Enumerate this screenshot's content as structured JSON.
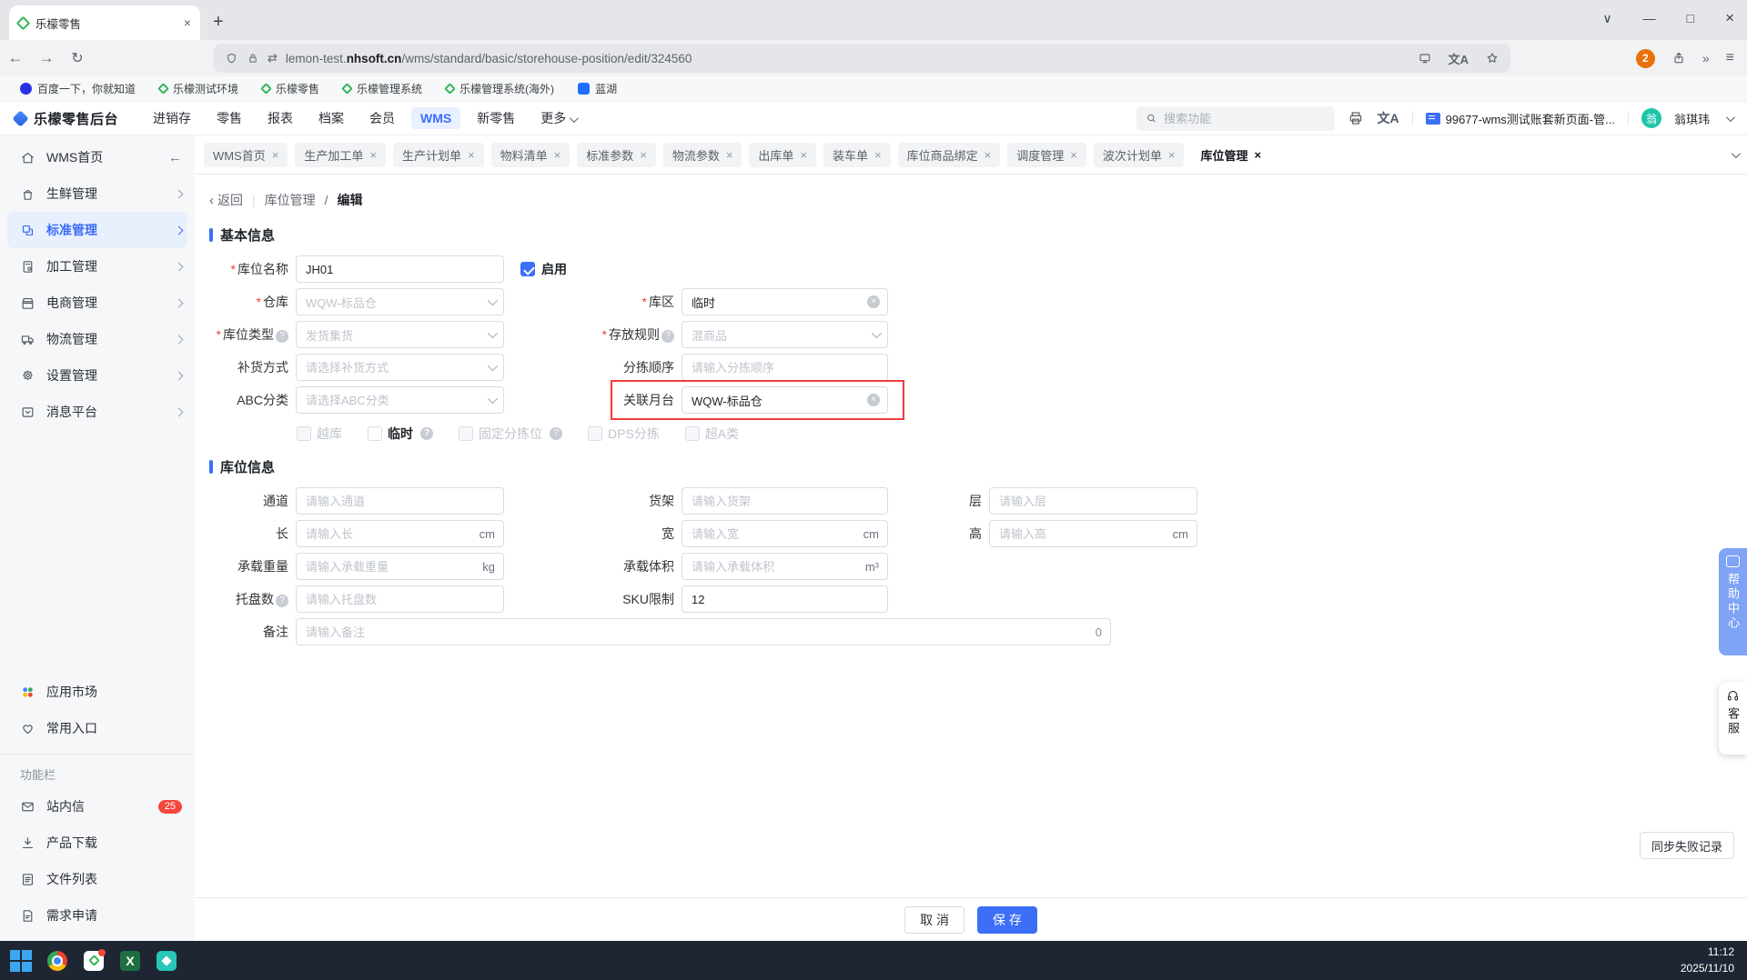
{
  "browser": {
    "tab_title": "乐檬零售",
    "url_prefix": "lemon-test.",
    "url_domain": "nhsoft.cn",
    "url_path": "/wms/standard/basic/storehouse-position/edit/324560",
    "profile_badge": "2",
    "bookmarks": [
      {
        "label": "百度一下，你就知道"
      },
      {
        "label": "乐檬测试环境"
      },
      {
        "label": "乐檬零售"
      },
      {
        "label": "乐檬管理系统"
      },
      {
        "label": "乐檬管理系统(海外)"
      },
      {
        "label": "蓝湖"
      }
    ],
    "glyphs": {
      "back": "←",
      "forward": "→",
      "reload": "↻",
      "newtab": "+",
      "close": "×",
      "min": "—",
      "max": "□",
      "caret": "∨",
      "more": "»",
      "menu": "≡",
      "switch": "⇄"
    }
  },
  "header": {
    "brand": "乐檬零售后台",
    "nav": [
      {
        "label": "进销存"
      },
      {
        "label": "零售"
      },
      {
        "label": "报表"
      },
      {
        "label": "档案"
      },
      {
        "label": "会员"
      },
      {
        "label": "WMS"
      },
      {
        "label": "新零售"
      },
      {
        "label": "更多"
      }
    ],
    "search_placeholder": "搜索功能",
    "translate_glyph": "文A",
    "account": "99677-wms测试账套新页面-管...",
    "avatar_char": "翁",
    "user_name": "翁琪玮"
  },
  "sidebar": {
    "items": [
      {
        "label": "WMS首页"
      },
      {
        "label": "生鲜管理"
      },
      {
        "label": "标准管理"
      },
      {
        "label": "加工管理"
      },
      {
        "label": "电商管理"
      },
      {
        "label": "物流管理"
      },
      {
        "label": "设置管理"
      },
      {
        "label": "消息平台"
      }
    ],
    "shortcuts": [
      {
        "label": "应用市场"
      },
      {
        "label": "常用入口"
      }
    ],
    "section_label": "功能栏",
    "tools": [
      {
        "label": "站内信",
        "badge": "25"
      },
      {
        "label": "产品下载"
      },
      {
        "label": "文件列表"
      },
      {
        "label": "需求申请"
      }
    ]
  },
  "tabs": {
    "items": [
      {
        "label": "WMS首页"
      },
      {
        "label": "生产加工单"
      },
      {
        "label": "生产计划单"
      },
      {
        "label": "物料清单"
      },
      {
        "label": "标准参数"
      },
      {
        "label": "物流参数"
      },
      {
        "label": "出库单"
      },
      {
        "label": "装车单"
      },
      {
        "label": "库位商品绑定"
      },
      {
        "label": "调度管理"
      },
      {
        "label": "波次计划单"
      },
      {
        "label": "库位管理"
      }
    ]
  },
  "page": {
    "breadcrumb": {
      "back": "返回",
      "parent": "库位管理",
      "sep": "/",
      "current": "编辑"
    },
    "sections": {
      "basic": "基本信息",
      "position": "库位信息"
    },
    "basic": {
      "name": {
        "label": "库位名称",
        "value": "JH01"
      },
      "enable": {
        "label": "启用"
      },
      "warehouse": {
        "label": "仓库",
        "value": "WQW-标品仓"
      },
      "area": {
        "label": "库区",
        "value": "临时"
      },
      "type": {
        "label": "库位类型",
        "value": "发货集货"
      },
      "rule": {
        "label": "存放规则",
        "value": "混商品"
      },
      "replenish": {
        "label": "补货方式",
        "placeholder": "请选择补货方式"
      },
      "pick_order": {
        "label": "分拣顺序",
        "placeholder": "请输入分拣顺序"
      },
      "abc": {
        "label": "ABC分类",
        "placeholder": "请选择ABC分类"
      },
      "dock": {
        "label": "关联月台",
        "value": "WQW-标品仓"
      },
      "checkboxes": [
        {
          "label": "越库"
        },
        {
          "label": "临时"
        },
        {
          "label": "固定分拣位"
        },
        {
          "label": "DPS分拣"
        },
        {
          "label": "超A类"
        }
      ]
    },
    "position": {
      "channel": {
        "label": "通道",
        "placeholder": "请输入通道"
      },
      "shelf": {
        "label": "货架",
        "placeholder": "请输入货架"
      },
      "layer": {
        "label": "层",
        "placeholder": "请输入层"
      },
      "length": {
        "label": "长",
        "placeholder": "请输入长",
        "unit": "cm"
      },
      "width": {
        "label": "宽",
        "placeholder": "请输入宽",
        "unit": "cm"
      },
      "height": {
        "label": "高",
        "placeholder": "请输入高",
        "unit": "cm"
      },
      "weight": {
        "label": "承载重量",
        "placeholder": "请输入承载重量",
        "unit": "kg"
      },
      "volume": {
        "label": "承载体积",
        "placeholder": "请输入承载体积",
        "unit": "m³"
      },
      "pallets": {
        "label": "托盘数",
        "placeholder": "请输入托盘数"
      },
      "sku": {
        "label": "SKU限制",
        "value": "12"
      },
      "remark": {
        "label": "备注",
        "placeholder": "请输入备注",
        "counter": "0"
      }
    },
    "sync_button": "同步失败记录",
    "footer": {
      "cancel": "取 消",
      "save": "保 存"
    }
  },
  "floating": {
    "help": "帮助中心",
    "service": "客服"
  },
  "taskbar": {
    "time": "11:12",
    "date": "2025/11/10"
  },
  "colors": {
    "accent": "#3D6EF7",
    "highlight_red": "#F23B3B",
    "badge_red": "#F5483B",
    "enabled_check": "#3D6EF7"
  }
}
